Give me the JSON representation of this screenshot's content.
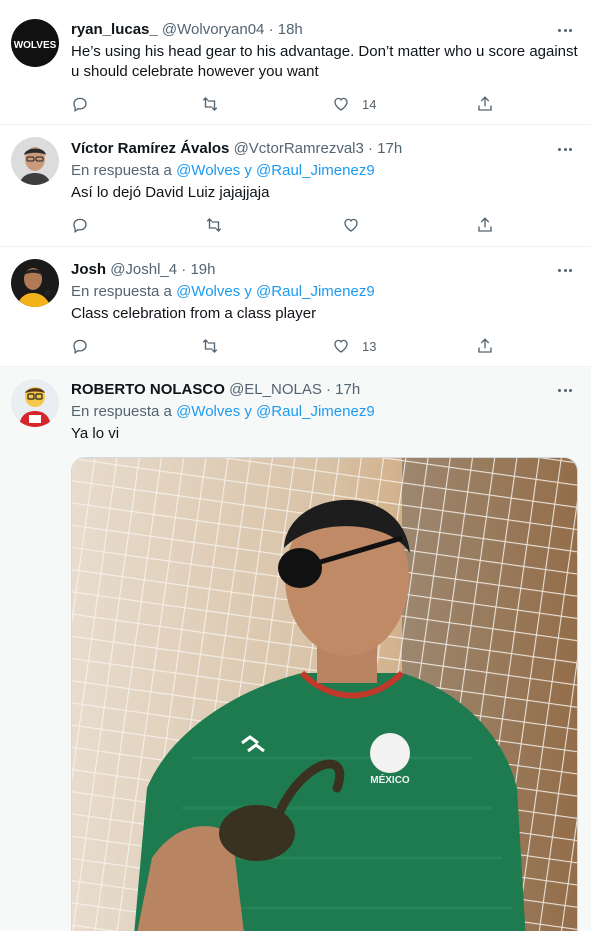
{
  "tweets": [
    {
      "name": "ryan_lucas_",
      "meta": "@Wolvoryan04 · 18h",
      "text": "He’s using his head gear to his advantage. Don’t matter who u score against u should celebrate however you want",
      "likes": "14",
      "avatar_text": "WOLVES"
    },
    {
      "name": "Víctor Ramírez Ávalos",
      "meta": "@VctorRamrezval3 · 17h",
      "reply_prefix": "En respuesta a",
      "reply_to": "@Wolves y @Raul_Jimenez9",
      "text": "Así lo dejó David Luiz jajajjaja"
    },
    {
      "name": "Josh",
      "meta": "@Joshl_4 · 19h",
      "reply_prefix": "En respuesta a",
      "reply_to": "@Wolves y @Raul_Jimenez9",
      "text": "Class celebration from a class player",
      "likes": "13"
    },
    {
      "name": "ROBERTO NOLASCO",
      "meta": "@EL_NOLAS · 17h",
      "reply_prefix": "En respuesta a",
      "reply_to": "@Wolves y @Raul_Jimenez9",
      "text": "Ya lo vi",
      "media_badge": "MÉXICO"
    }
  ],
  "icons": {
    "reply": "reply-icon",
    "retweet": "retweet-icon",
    "like": "heart-icon",
    "share": "share-icon",
    "more": "more-icon"
  },
  "colors": {
    "link": "#1d9bf0",
    "secondary": "#536471",
    "jersey": "#1e7a4f",
    "highlight_bg": "#f7f9f9"
  }
}
